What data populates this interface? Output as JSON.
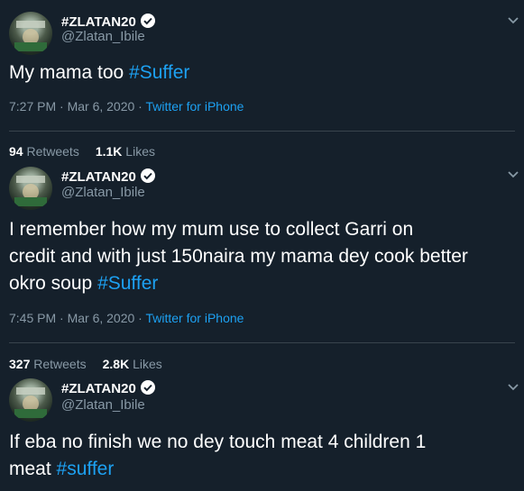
{
  "tweets": [
    {
      "display_name": "#ZLATAN20",
      "handle": "@Zlatan_Ibile",
      "text_prefix": "My mama too ",
      "hashtag": "#Suffer",
      "time": "7:27 PM · Mar 6, 2020 · ",
      "source": "Twitter for iPhone",
      "retweets": "94",
      "retweets_label": " Retweets",
      "likes": "1.1K",
      "likes_label": " Likes"
    },
    {
      "display_name": "#ZLATAN20",
      "handle": "@Zlatan_Ibile",
      "line1": "I remember how my  mum use to collect Garri  on",
      "line2": "credit and with just 150naira my mama dey cook better",
      "line3_prefix": "okro soup ",
      "hashtag": "#Suffer",
      "time": "7:45 PM · Mar 6, 2020 · ",
      "source": "Twitter for iPhone",
      "retweets": "327",
      "retweets_label": " Retweets",
      "likes": "2.8K",
      "likes_label": " Likes"
    },
    {
      "display_name": "#ZLATAN20",
      "handle": "@Zlatan_Ibile",
      "line1": "If eba no finish we no dey touch meat  4 children 1",
      "line2_prefix": "meat ",
      "hashtag": "#suffer"
    }
  ],
  "icons": {
    "verified": "verified-badge-icon",
    "caret": "chevron-down-icon"
  },
  "colors": {
    "background": "#15202b",
    "link": "#1da1f2",
    "muted": "#8899a6",
    "divider": "#38444d"
  }
}
